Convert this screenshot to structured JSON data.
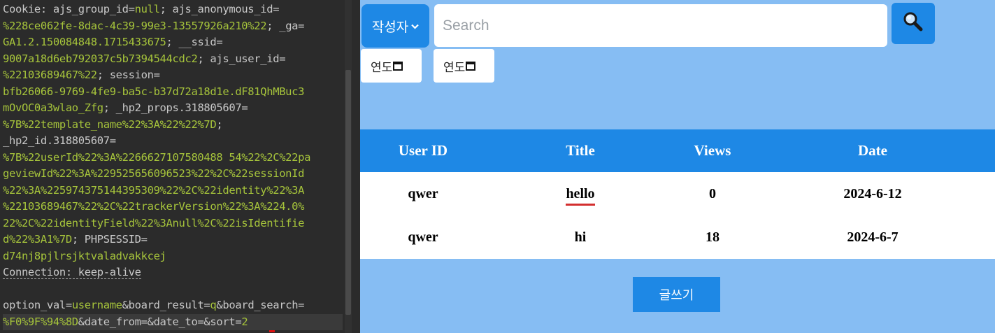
{
  "editor": {
    "lines": [
      [
        {
          "t": "Cookie: ajs_group_id=",
          "c": "h"
        },
        {
          "t": "null",
          "c": "v"
        },
        {
          "t": "; ajs_anonymous_id=",
          "c": "h"
        }
      ],
      [
        {
          "t": "%228ce062fe-8dac-4c39-99e3-13557926a210%22",
          "c": "v"
        },
        {
          "t": "; _ga=",
          "c": "h"
        }
      ],
      [
        {
          "t": "GA1.2.150084848.1715433675",
          "c": "v"
        },
        {
          "t": "; __ssid=",
          "c": "h"
        }
      ],
      [
        {
          "t": "9007a18d6eb792037c5b7394544cdc2",
          "c": "v"
        },
        {
          "t": "; ajs_user_id=",
          "c": "h"
        }
      ],
      [
        {
          "t": "%22103689467%22",
          "c": "v"
        },
        {
          "t": "; session=",
          "c": "h"
        }
      ],
      [
        {
          "t": "bfb26066-9769-4fe9-ba5c-b37d72a18d1e.dF81QhMBuc3",
          "c": "v"
        }
      ],
      [
        {
          "t": "mOvOC0a3wlao_Zfg",
          "c": "v"
        },
        {
          "t": "; _hp2_props.318805607=",
          "c": "h"
        }
      ],
      [
        {
          "t": "%7B%22template_name%22%3A%22%22%7D",
          "c": "v"
        },
        {
          "t": ";",
          "c": "h"
        }
      ],
      [
        {
          "t": "_hp2_id.318805607=",
          "c": "h"
        }
      ],
      [
        {
          "t": "%7B%22userId%22%3A%2266627107580488 54%22%2C%22pa",
          "c": "v"
        }
      ],
      [
        {
          "t": "geviewId%22%3A%229525656096523%22%2C%22sessionId",
          "c": "v"
        }
      ],
      [
        {
          "t": "%22%3A%225974375144395309%22%2C%22identity%22%3A",
          "c": "v"
        }
      ],
      [
        {
          "t": "%22103689467%22%2C%22trackerVersion%22%3A%224.0%",
          "c": "v"
        }
      ],
      [
        {
          "t": "22%2C%22identityField%22%3Anull%2C%22isIdentifie",
          "c": "v"
        }
      ],
      [
        {
          "t": "d%22%3A1%7D",
          "c": "v"
        },
        {
          "t": "; PHPSESSID=",
          "c": "h"
        }
      ],
      [
        {
          "t": "d74nj8pjlrsjktvaladvakkcej",
          "c": "v"
        }
      ],
      [
        {
          "t": "Connection: keep-alive",
          "c": "h",
          "u": true
        }
      ],
      [],
      [
        {
          "t": "option_val=",
          "c": "h"
        },
        {
          "t": "username",
          "c": "v"
        },
        {
          "t": "&board_result=",
          "c": "h"
        },
        {
          "t": "q",
          "c": "v"
        },
        {
          "t": "&board_search=",
          "c": "h"
        }
      ],
      [
        {
          "t": "%F0%9F%94%8D",
          "c": "v"
        },
        {
          "t": "&date_from=&date_to=&sort=",
          "c": "h"
        },
        {
          "t": "2",
          "c": "v"
        }
      ]
    ]
  },
  "web": {
    "author_select": {
      "label": "작성자"
    },
    "search": {
      "placeholder": "Search",
      "value": ""
    },
    "search_button": {
      "icon": "search-icon"
    },
    "date_from": {
      "label": "연도"
    },
    "date_to": {
      "label": "연도"
    },
    "table": {
      "columns": [
        "User ID",
        "Title",
        "Views",
        "Date"
      ],
      "rows": [
        {
          "user_id": "qwer",
          "title": "hello",
          "views": "0",
          "date": "2024-6-12"
        },
        {
          "user_id": "qwer",
          "title": "hi",
          "views": "18",
          "date": "2024-6-7"
        }
      ]
    },
    "write_button": {
      "label": "글쓰기"
    }
  },
  "colors": {
    "page_bg": "#86bdf3",
    "accent": "#1e88e5",
    "editor_bg": "#2b2b2b",
    "editor_value": "#a6c43b",
    "editor_text": "#c8c8c8",
    "highlight_underline": "#d32f2f"
  }
}
